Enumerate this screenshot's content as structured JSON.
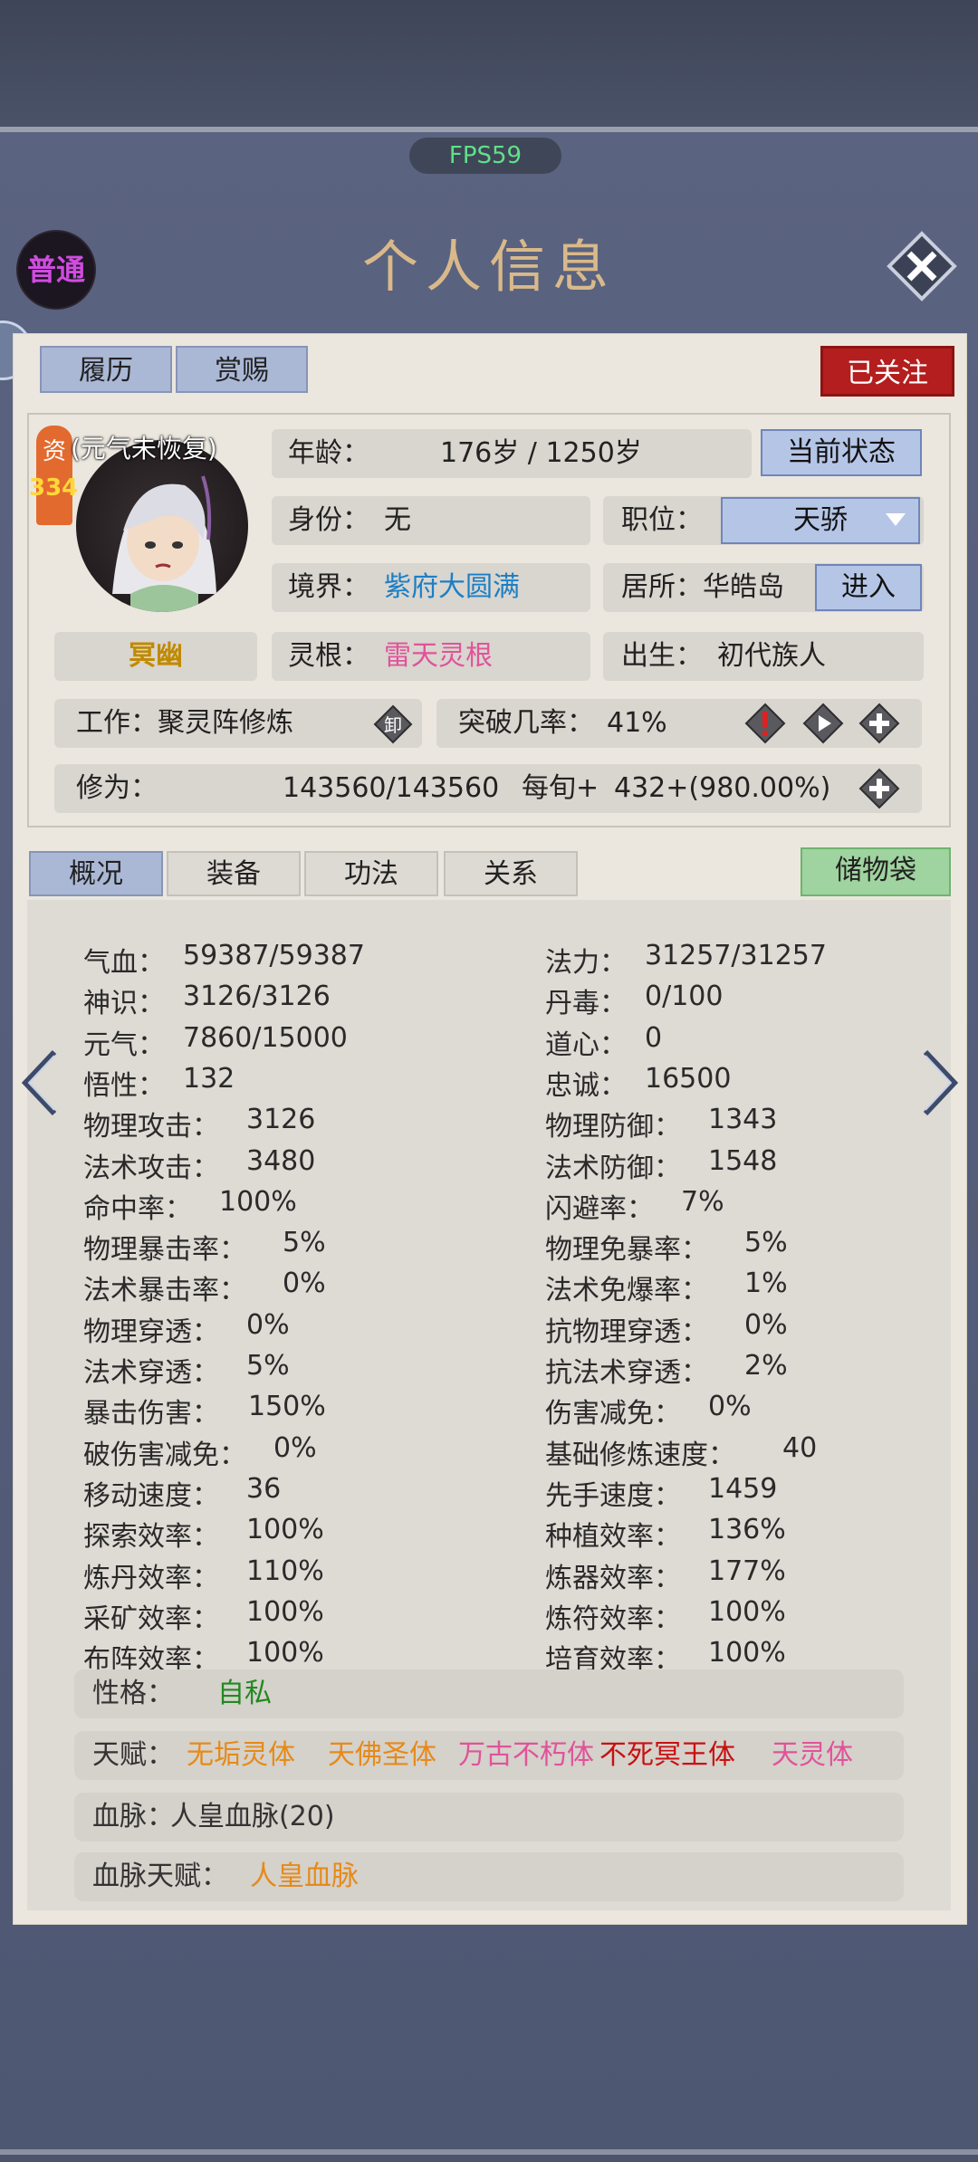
{
  "fps": "FPS59",
  "mode_badge": "普通",
  "title": "个人信息",
  "top_tabs": [
    "履历",
    "赏赐"
  ],
  "follow": "已关注",
  "portrait": {
    "vital_note": "(元气未恢复)",
    "aptitude_label": "资",
    "aptitude_value": "334",
    "name": "冥幽"
  },
  "age": {
    "label": "年龄：",
    "value": "176岁 / 1250岁"
  },
  "current_state_btn": "当前状态",
  "identity": {
    "label": "身份：",
    "value": "无"
  },
  "position": {
    "label": "职位：",
    "value": "天骄"
  },
  "realm": {
    "label": "境界：",
    "value": "紫府大圆满"
  },
  "residence": {
    "label": "居所：",
    "value": "华皓岛",
    "enter": "进入"
  },
  "spirit_root": {
    "label": "灵根：",
    "value": "雷天灵根"
  },
  "birth": {
    "label": "出生：",
    "value": "初代族人"
  },
  "work": {
    "label": "工作：",
    "value": "聚灵阵修炼",
    "icon_text": "卸"
  },
  "breakthrough": {
    "label": "突破几率：",
    "value": "41%"
  },
  "cultivation": {
    "label": "修为：",
    "value": "143560/143560",
    "per_label": "每旬+",
    "per_value": "432+(980.00%)"
  },
  "tabs": [
    "概况",
    "装备",
    "功法",
    "关系"
  ],
  "storage_bag": "储物袋",
  "stats_left": [
    {
      "label": "气血：",
      "value": "59387/59387"
    },
    {
      "label": "神识：",
      "value": "3126/3126"
    },
    {
      "label": "元气：",
      "value": "7860/15000"
    },
    {
      "label": "悟性：",
      "value": "132"
    },
    {
      "label": "物理攻击：",
      "value": "3126"
    },
    {
      "label": "法术攻击：",
      "value": "3480"
    },
    {
      "label": "命中率：",
      "value": "100%"
    },
    {
      "label": "物理暴击率：",
      "value": "5%"
    },
    {
      "label": "法术暴击率：",
      "value": "0%"
    },
    {
      "label": "物理穿透：",
      "value": "0%"
    },
    {
      "label": "法术穿透：",
      "value": "5%"
    },
    {
      "label": "暴击伤害：",
      "value": "150%"
    },
    {
      "label": "破伤害减免：",
      "value": "0%"
    },
    {
      "label": "移动速度：",
      "value": "36"
    },
    {
      "label": "探索效率：",
      "value": "100%"
    },
    {
      "label": "炼丹效率：",
      "value": "110%"
    },
    {
      "label": "采矿效率：",
      "value": "100%"
    },
    {
      "label": "布阵效率：",
      "value": "100%"
    }
  ],
  "stats_right": [
    {
      "label": "法力：",
      "value": "31257/31257"
    },
    {
      "label": "丹毒：",
      "value": "0/100"
    },
    {
      "label": "道心：",
      "value": "0"
    },
    {
      "label": "忠诚：",
      "value": "16500"
    },
    {
      "label": "物理防御：",
      "value": "1343"
    },
    {
      "label": "法术防御：",
      "value": "1548"
    },
    {
      "label": "闪避率：",
      "value": "7%"
    },
    {
      "label": "物理免暴率：",
      "value": "5%"
    },
    {
      "label": "法术免爆率：",
      "value": "1%"
    },
    {
      "label": "抗物理穿透：",
      "value": "0%"
    },
    {
      "label": "抗法术穿透：",
      "value": "2%"
    },
    {
      "label": "伤害减免：",
      "value": "0%"
    },
    {
      "label": "基础修炼速度：",
      "value": "40"
    },
    {
      "label": "先手速度：",
      "value": "1459"
    },
    {
      "label": "种植效率：",
      "value": "136%"
    },
    {
      "label": "炼器效率：",
      "value": "177%"
    },
    {
      "label": "炼符效率：",
      "value": "100%"
    },
    {
      "label": "培育效率：",
      "value": "100%"
    }
  ],
  "personality": {
    "label": "性格：",
    "value": "自私"
  },
  "talents": {
    "label": "天赋：",
    "items": [
      "无垢灵体",
      "天佛圣体",
      "万古不朽体",
      "不死冥王体",
      "天灵体"
    ]
  },
  "bloodline": {
    "label": "血脉：",
    "value": "人皇血脉(20)"
  },
  "bloodline_talent": {
    "label": "血脉天赋：",
    "value": "人皇血脉"
  }
}
